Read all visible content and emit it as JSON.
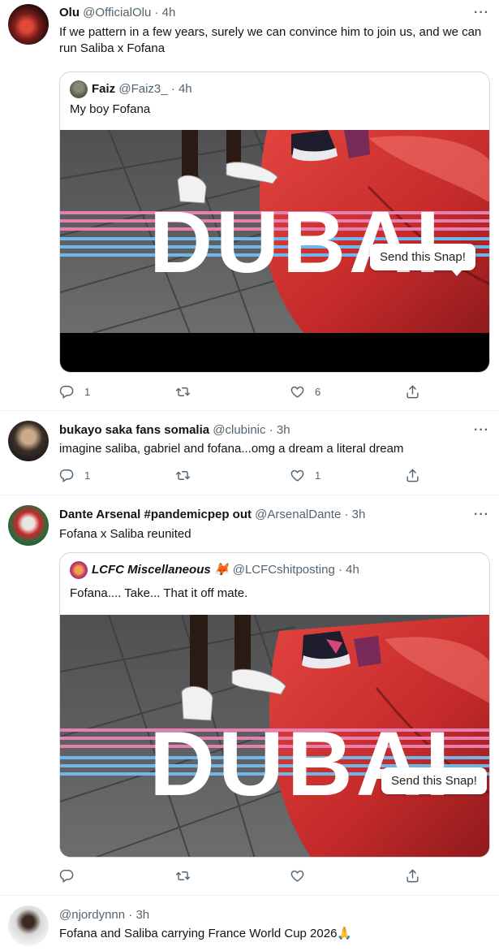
{
  "tweets": [
    {
      "name": "Olu",
      "handle": "@OfficialOlu",
      "time": "· 4h",
      "text": "If we pattern in a few years, surely we can convince him to join us, and we can run Saliba x Fofana",
      "quote": {
        "name": "Faiz",
        "handle": "@Faiz3_",
        "time": "· 4h",
        "text": "My boy Fofana",
        "media_title": "DUBAI",
        "snap_label": "Send this Snap!"
      },
      "actions": {
        "reply": "1",
        "retweet": "",
        "like": "6"
      }
    },
    {
      "name": "bukayo saka fans somalia",
      "handle": "@clubinic",
      "time": "· 3h",
      "text": "imagine saliba, gabriel and fofana...omg a dream a literal dream",
      "actions": {
        "reply": "1",
        "retweet": "",
        "like": "1"
      }
    },
    {
      "name": "Dante Arsenal #pandemicpep out",
      "handle": "@ArsenalDante",
      "time": "· 3h",
      "text": "Fofana x Saliba reunited",
      "quote": {
        "name": "LCFC Miscellaneous 🦊",
        "handle": "@LCFCshitposting",
        "time": "· 4h",
        "text": "Fofana.... Take... That it off mate.",
        "media_title": "DUBAI",
        "snap_label": "Send this Snap!"
      },
      "actions": {
        "reply": "",
        "retweet": "",
        "like": ""
      }
    },
    {
      "name": "",
      "handle": "@njordynnn",
      "time": "· 3h",
      "text": "Fofana and Saliba carrying France World Cup 2026🙏"
    }
  ],
  "more_label": "···",
  "icons": [
    "reply-icon",
    "retweet-icon",
    "like-icon",
    "share-icon",
    "more-icon"
  ],
  "colors": {
    "text": "#0f1419",
    "muted": "#536471",
    "border": "#cfd9de",
    "divider": "#eff3f4"
  }
}
